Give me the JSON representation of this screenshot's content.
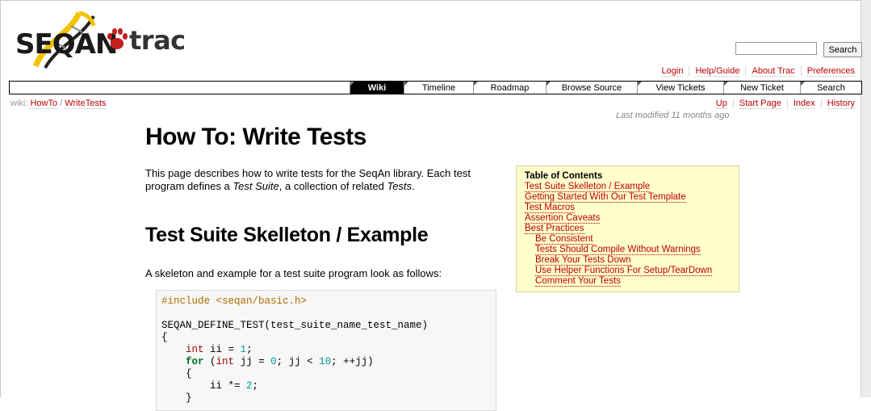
{
  "logo": {
    "seqan": "SEQAN",
    "trac": "trac"
  },
  "search": {
    "placeholder": "",
    "value": "",
    "button_label": "Search"
  },
  "metanav": [
    "Login",
    "Help/Guide",
    "About Trac",
    "Preferences"
  ],
  "mainnav": [
    {
      "label": "Wiki",
      "active": true
    },
    {
      "label": "Timeline",
      "active": false
    },
    {
      "label": "Roadmap",
      "active": false
    },
    {
      "label": "Browse Source",
      "active": false
    },
    {
      "label": "View Tickets",
      "active": false
    },
    {
      "label": "New Ticket",
      "active": false
    },
    {
      "label": "Search",
      "active": false
    }
  ],
  "breadcrumb": {
    "prefix": "wiki:",
    "parts": [
      "HowTo",
      "WriteTests"
    ],
    "separator": "/"
  },
  "ctxnav": [
    "Up",
    "Start Page",
    "Index",
    "History"
  ],
  "last_modified": {
    "prefix": "Last modified",
    "age": "11 months",
    "suffix": "ago"
  },
  "page": {
    "title": "How To: Write Tests",
    "intro_1": "This page describes how to write tests for the SeqAn library. Each test program defines a ",
    "intro_em1": "Test Suite",
    "intro_2": ", a collection of related ",
    "intro_em2": "Tests",
    "intro_3": ".",
    "section_title": "Test Suite Skelleton / Example",
    "skeleton_text": "A skeleton and example for a test suite program look as follows:"
  },
  "code": {
    "include": "#include <seqan/basic.h>",
    "define": "SEQAN_DEFINE_TEST(test_suite_name_test_name)",
    "open_brace": "{",
    "int_kw": "int",
    "ii_decl": " ii = ",
    "one": "1",
    "semi": ";",
    "for_kw": "for",
    "for_rest_1": " (",
    "for_int": "int",
    "for_rest_2": " jj = ",
    "zero": "0",
    "for_rest_3": "; jj < ",
    "ten": "10",
    "for_rest_4": "; ++jj)",
    "inner_open": "{",
    "ii_mul": "ii *= ",
    "two": "2",
    "inner_close": "}"
  },
  "toc": {
    "title": "Table of Contents",
    "items": [
      {
        "label": "Test Suite Skelleton / Example",
        "sub": false
      },
      {
        "label": "Getting Started With Our Test Template",
        "sub": false
      },
      {
        "label": "Test Macros",
        "sub": false
      },
      {
        "label": "Assertion Caveats",
        "sub": false
      },
      {
        "label": "Best Practices",
        "sub": false
      },
      {
        "label": "Be Consistent",
        "sub": true
      },
      {
        "label": "Tests Should Compile Without Warnings",
        "sub": true
      },
      {
        "label": "Break Your Tests Down",
        "sub": true
      },
      {
        "label": "Use Helper Functions For Setup/TearDown",
        "sub": true
      },
      {
        "label": "Comment Your Tests",
        "sub": true
      }
    ]
  },
  "colors": {
    "link": "#bb0000",
    "toc_bg": "#ffffcc",
    "active_tab": "#000000",
    "logo_yellow": "#f2c200",
    "logo_red": "#c61d1d"
  }
}
